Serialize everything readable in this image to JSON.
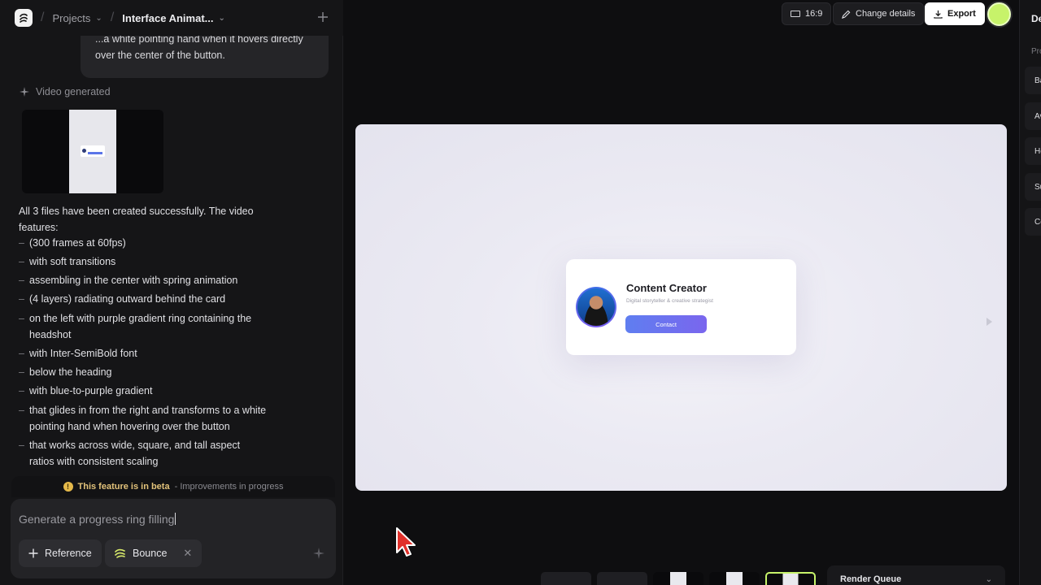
{
  "breadcrumb": {
    "projects": "Projects",
    "project": "Interface Animat..."
  },
  "chat": {
    "user_message": "...a white pointing hand when it hovers directly over the center of the button.",
    "video_label": "Video generated",
    "summary": "All 3 files have been created successfully. The video features:",
    "features": [
      "(300 frames at 60fps)",
      "with soft transitions",
      "assembling in the center with spring animation",
      "(4 layers) radiating outward behind the card",
      "on the left with purple gradient ring containing the headshot",
      "with Inter-SemiBold font",
      "below the heading",
      "with blue-to-purple gradient",
      "that glides in from the right and transforms to a white pointing hand when hovering over the button",
      "that works across wide, square, and tall aspect ratios with consistent scaling"
    ]
  },
  "beta": {
    "strong": "This feature is in beta",
    "rest": " - Improvements in progress"
  },
  "composer": {
    "value": "Generate a progress ring filling",
    "reference_label": "Reference",
    "style_label": "Bounce"
  },
  "toolbar": {
    "ratio": "16:9",
    "change_details": "Change details",
    "export": "Export"
  },
  "canvas": {
    "card_title": "Content Creator",
    "card_subtitle": "Digital storyteller & creative strategist",
    "card_button": "Contact"
  },
  "timeline": {
    "render_queue": "Render Queue"
  },
  "right_panel": {
    "title": "De",
    "section": "Pro",
    "items": [
      "Ba",
      "Av",
      "He",
      "Su",
      "Co"
    ]
  },
  "colors": {
    "accent": "#c7f36a",
    "button_start": "#5f7ef0",
    "button_end": "#7a66ee",
    "beta": "#e5b94a"
  }
}
